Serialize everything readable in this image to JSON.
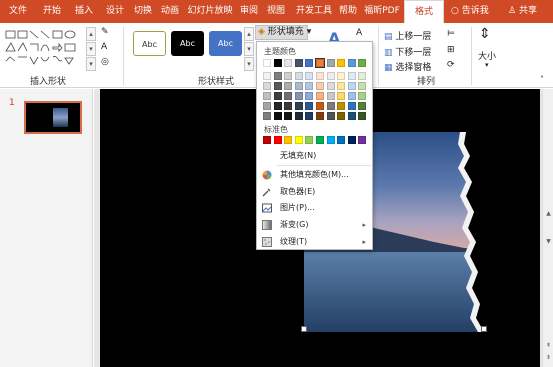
{
  "tabs": [
    "文件",
    "开始",
    "插入",
    "设计",
    "切换",
    "动画",
    "幻灯片放映",
    "审阅",
    "视图",
    "开发工具",
    "帮助",
    "福昕PDF",
    "格式"
  ],
  "tell_me": "告诉我",
  "share": "共享",
  "ribbon": {
    "group_insert_shapes": "插入形状",
    "group_shape_styles": "形状样式",
    "group_arrange": "排列",
    "style_sample": "Abc",
    "shape_fill_label": "形状填充",
    "shape_fill_arrow": "▾",
    "bring_forward": "上移一层",
    "send_backward": "下移一层",
    "selection_pane": "选择窗格",
    "size": "大小"
  },
  "slide_panel": {
    "slide_number": "1"
  },
  "fill_menu": {
    "theme_colors_header": "主题颜色",
    "standard_colors_header": "标准色",
    "no_fill": "无填充(N)",
    "more_fill_colors": "其他填充颜色(M)...",
    "eyedropper": "取色器(E)",
    "picture": "图片(P)...",
    "gradient": "渐变(G)",
    "texture": "纹理(T)",
    "submenu_arrow": "▸",
    "theme_top_row": [
      "#ffffff",
      "#000000",
      "#e7e6e6",
      "#44546a",
      "#4472c4",
      "#ed7d31",
      "#a5a5a5",
      "#ffc000",
      "#5b9bd5",
      "#70ad47"
    ],
    "theme_shades": [
      [
        "#f2f2f2",
        "#7f7f7f",
        "#d0cece",
        "#d6dce4",
        "#d9e2f3",
        "#fbe5d5",
        "#ededed",
        "#fff2cc",
        "#deebf6",
        "#e2efd9"
      ],
      [
        "#d9d9d9",
        "#595959",
        "#aeabab",
        "#adb9ca",
        "#b4c6e7",
        "#f7cbac",
        "#dbdbdb",
        "#fee599",
        "#bdd7ee",
        "#c5e0b3"
      ],
      [
        "#bfbfbf",
        "#3f3f3f",
        "#757070",
        "#8496b0",
        "#8eaadb",
        "#f4b183",
        "#c9c9c9",
        "#ffd965",
        "#9dc3e6",
        "#a8d08d"
      ],
      [
        "#a5a5a5",
        "#262626",
        "#3a3838",
        "#323f4f",
        "#2f5496",
        "#c55a11",
        "#7b7b7b",
        "#bf9000",
        "#2e75b5",
        "#538135"
      ],
      [
        "#7f7f7f",
        "#0c0c0c",
        "#171616",
        "#222a35",
        "#1f3864",
        "#833c0b",
        "#525252",
        "#7f6000",
        "#1f4e79",
        "#375623"
      ]
    ],
    "standard_colors": [
      "#c00000",
      "#ff0000",
      "#ffc000",
      "#ffff00",
      "#92d050",
      "#00b050",
      "#00b0f0",
      "#0070c0",
      "#002060",
      "#7030a0"
    ]
  }
}
